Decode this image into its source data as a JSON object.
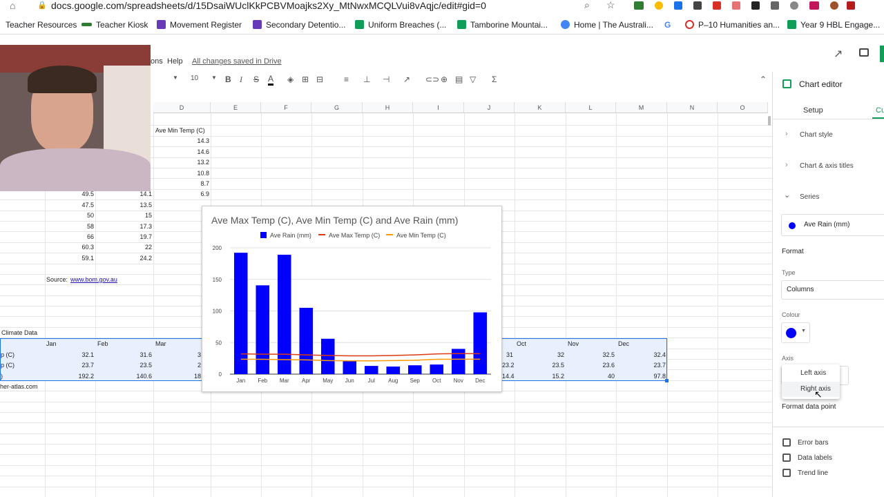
{
  "browser": {
    "url": "docs.google.com/spreadsheets/d/15DsaiWUclKkPCBVMoajks2Xy_MtNwxMCQLVui8vAqjc/edit#gid=0",
    "bookmarks": [
      {
        "label": "Teacher Resources",
        "color": "#5f6368"
      },
      {
        "label": "Teacher Kiosk",
        "color": "#2e7d32"
      },
      {
        "label": "Movement Register",
        "color": "#673ab7"
      },
      {
        "label": "Secondary Detentio...",
        "color": "#673ab7"
      },
      {
        "label": "Uniform Breaches (...",
        "color": "#0f9d58"
      },
      {
        "label": "Tamborine Mountai...",
        "color": "#0f9d58"
      },
      {
        "label": "Home | The Australi...",
        "color": "#4285f4"
      },
      {
        "label": "",
        "color": "#4285f4"
      },
      {
        "label": "P–10 Humanities an...",
        "color": "#d32f2f"
      },
      {
        "label": "Year 9 HBL Engage...",
        "color": "#0f9d58"
      }
    ]
  },
  "menu": {
    "partial": "ons",
    "help": "Help",
    "saved": "All changes saved in Drive"
  },
  "toolbar": {
    "font_size": "10",
    "bold": "B",
    "italic": "I",
    "strike": "S",
    "text_color": "A",
    "sigma": "Σ"
  },
  "grid": {
    "columns": [
      "D",
      "E",
      "F",
      "G",
      "H",
      "I",
      "J",
      "K",
      "L",
      "M",
      "N",
      "O"
    ],
    "header_d": "Ave Min Temp (C)",
    "d_values": [
      "14.3",
      "14.6",
      "13.2",
      "10.8",
      "8.7",
      "6.9"
    ],
    "rain_partial": [
      "49.5",
      "47.5",
      "50",
      "58",
      "66",
      "60.3",
      "59.1"
    ],
    "max_partial": [
      "14.1",
      "13.5",
      "15",
      "17.3",
      "19.7",
      "22",
      "24.2"
    ],
    "source_label": "Source:",
    "source_link": "www.bom.gov.au",
    "climate_label": "Climate Data",
    "months_left": [
      "Jan",
      "Feb",
      "Mar"
    ],
    "months_right": [
      "Oct",
      "Nov",
      "Dec"
    ],
    "row_labels": [
      "p (C)",
      "p (C)",
      ")"
    ],
    "jan": [
      "32.1",
      "23.7",
      "192.2"
    ],
    "feb": [
      "31.6",
      "23.5",
      "140.6"
    ],
    "mar": [
      "3",
      "2",
      "18"
    ],
    "left_of_oct": [
      "31",
      "23.2",
      "14.4"
    ],
    "oct": [
      "32",
      "23.5",
      "15.2"
    ],
    "nov": [
      "32.5",
      "23.6",
      "40"
    ],
    "dec": [
      "32.4",
      "23.7",
      "97.8"
    ],
    "footer": "her-atlas.com"
  },
  "chart_data": {
    "type": "bar",
    "title": "Ave Max Temp (C), Ave Min Temp (C) and Ave Rain (mm)",
    "categories": [
      "Jan",
      "Feb",
      "Mar",
      "Apr",
      "May",
      "Jun",
      "Jul",
      "Aug",
      "Sep",
      "Oct",
      "Nov",
      "Dec"
    ],
    "series": [
      {
        "name": "Ave Rain (mm)",
        "kind": "bar",
        "color": "#0000ff",
        "values": [
          192.2,
          140.6,
          189.0,
          105.0,
          56.0,
          21.0,
          13.0,
          12.0,
          14.0,
          15.2,
          40.0,
          97.8
        ]
      },
      {
        "name": "Ave Max Temp (C)",
        "kind": "line",
        "color": "#dc3912",
        "values": [
          32.1,
          31.6,
          31.5,
          30.5,
          29.5,
          29.0,
          29.0,
          29.5,
          30.5,
          32.0,
          32.5,
          32.4
        ]
      },
      {
        "name": "Ave Min Temp (C)",
        "kind": "line",
        "color": "#ff9900",
        "values": [
          23.7,
          23.5,
          23.0,
          22.5,
          21.5,
          21.0,
          21.0,
          21.5,
          22.0,
          23.5,
          23.6,
          23.7
        ]
      }
    ],
    "ylim": [
      0,
      200
    ],
    "yticks": [
      "0",
      "50",
      "100",
      "150",
      "200"
    ],
    "legend": "top",
    "grid": true
  },
  "sidebar": {
    "title": "Chart editor",
    "tab_setup": "Setup",
    "tab_customise": "Cu",
    "chart_style": "Chart style",
    "chart_axis_titles": "Chart & axis titles",
    "series": "Series",
    "series_selected": "Ave Rain (mm)",
    "series_color": "#0000ff",
    "format": "Format",
    "type_label": "Type",
    "type_value": "Columns",
    "colour_label": "Colour",
    "axis_label": "Axis",
    "axis_options": [
      "Left axis",
      "Right axis"
    ],
    "format_data_point": "Format data point",
    "checkboxes": [
      "Error bars",
      "Data labels",
      "Trend line"
    ]
  }
}
